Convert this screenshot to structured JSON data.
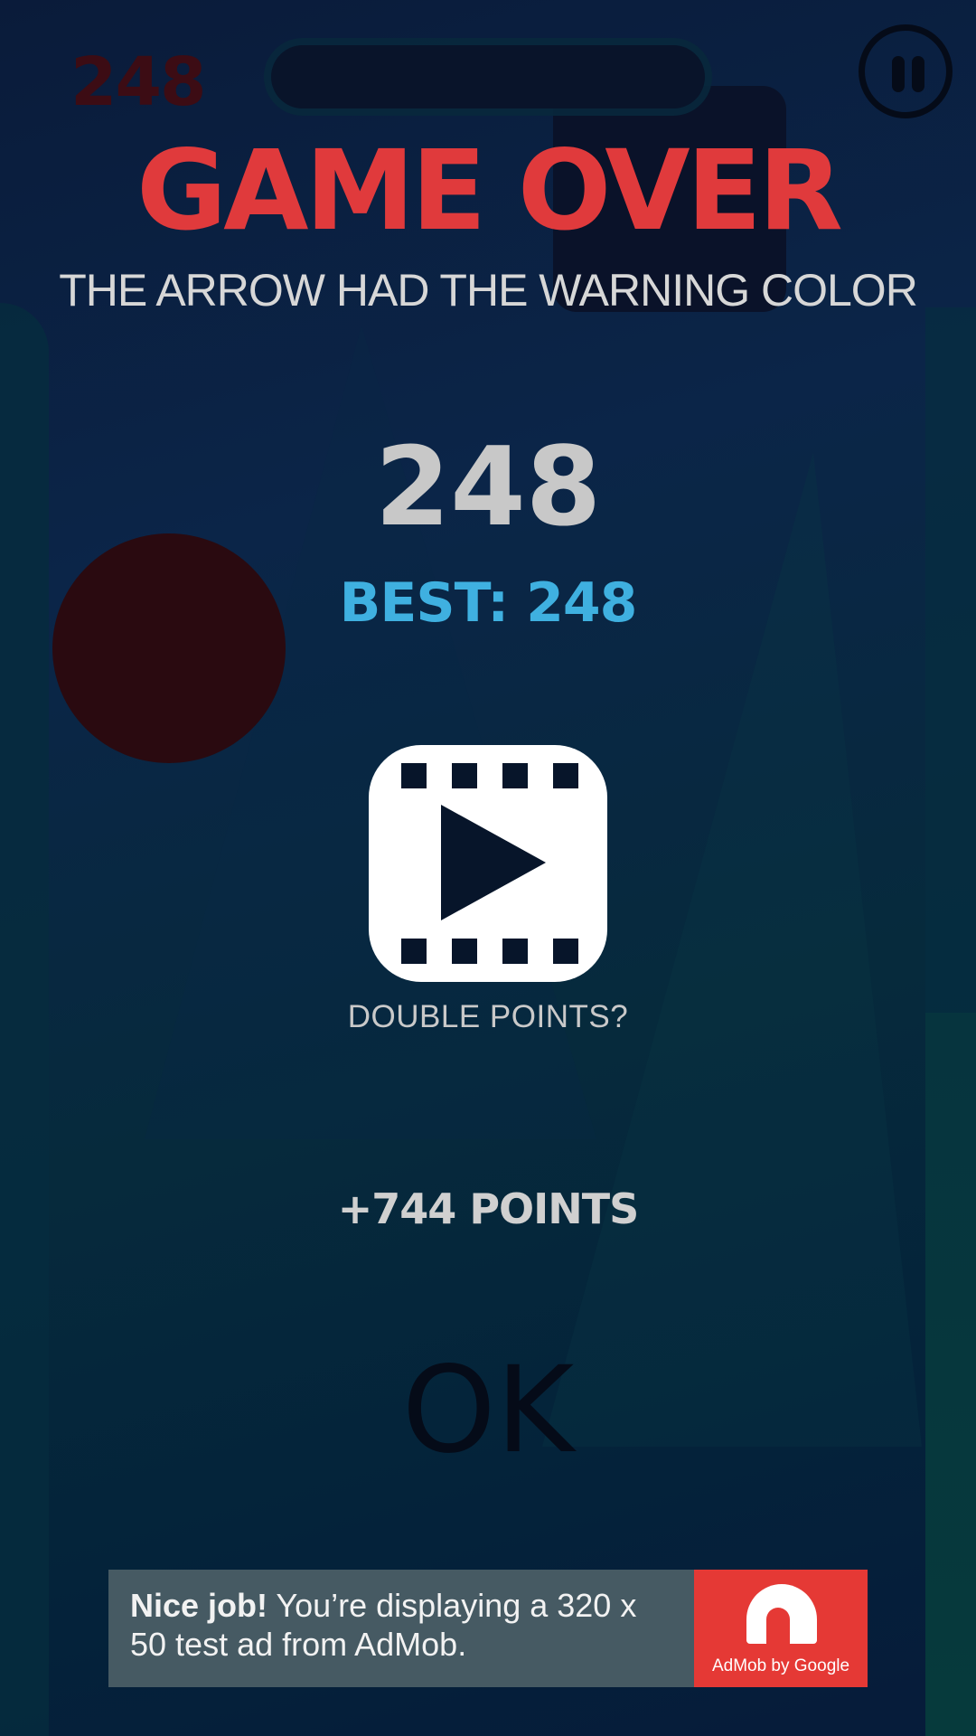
{
  "hud": {
    "score": "248",
    "progress_fraction": 0.0
  },
  "game_over": {
    "title": "GAME OVER",
    "reason": "THE ARROW HAD THE WARNING COLOR",
    "score": "248",
    "best": "BEST: 248"
  },
  "reward": {
    "video_icon": "film-play-icon",
    "label": "DOUBLE POINTS?",
    "points": "+744 POINTS"
  },
  "ok_label": "OK",
  "ad": {
    "headline": "Nice job!",
    "body": " You’re displaying a 320 x 50 test ad from AdMob.",
    "logo_text": "AdMob by Google"
  },
  "colors": {
    "title": "#e03a3c",
    "best": "#3fb0e0",
    "ad_background": "#465a63",
    "ad_logo": "#e53935"
  }
}
